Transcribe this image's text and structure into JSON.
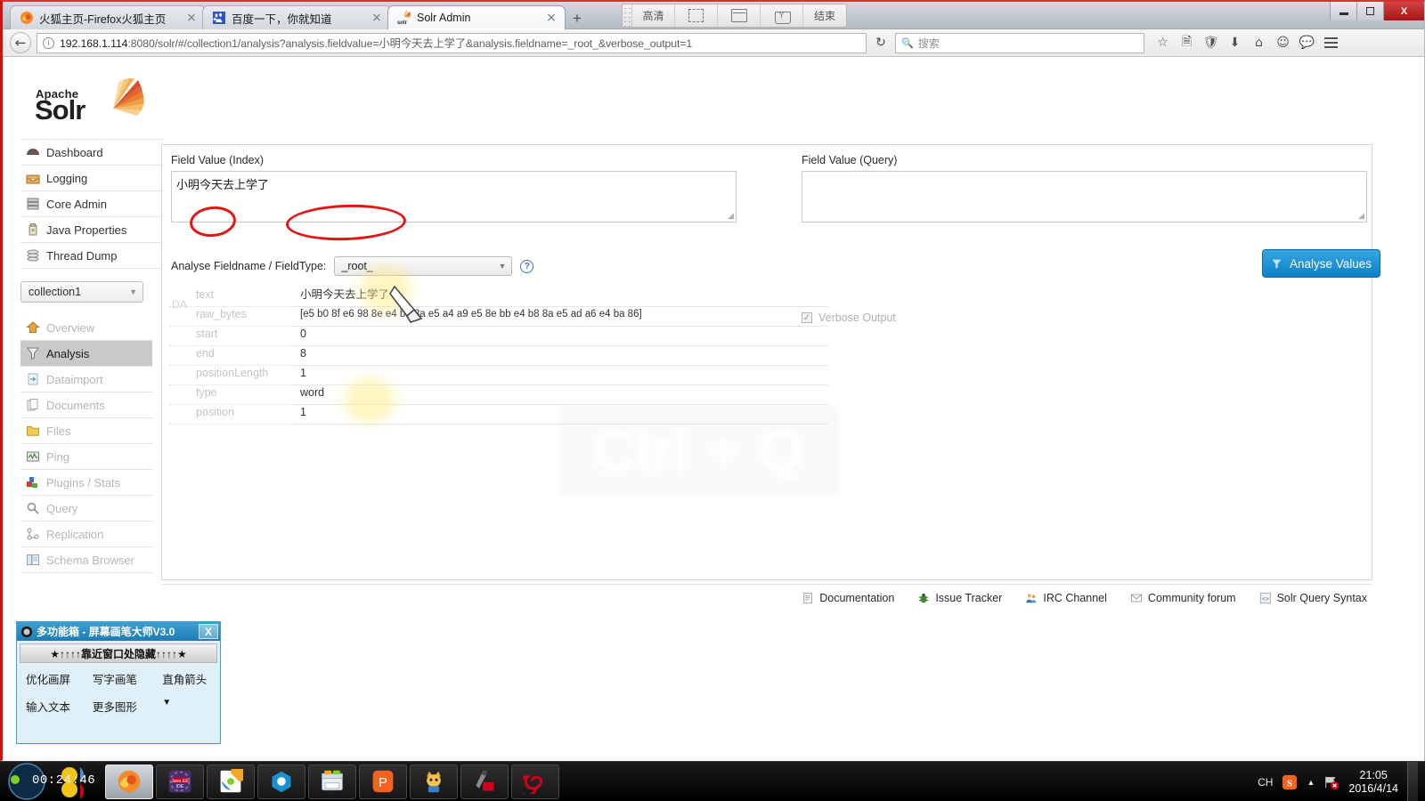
{
  "browser": {
    "tabs": [
      {
        "title": "火狐主页-Firefox火狐主页",
        "favicon": "firefox-icon",
        "active": false,
        "close": "×"
      },
      {
        "title": "百度一下，你就知道",
        "favicon": "baidu-icon",
        "active": false,
        "close": "×"
      },
      {
        "title": "Solr Admin",
        "favicon": "solr-icon",
        "active": true,
        "close": "×"
      }
    ],
    "new_tab_label": "+",
    "capture_toolbar": {
      "hd_label": "高清",
      "region_label": "region-select-icon",
      "window_label": "window-capture-icon",
      "scroll_label": "scroll-capture-icon",
      "end_label": "结束"
    },
    "window_controls": {
      "minimize": "minimize-icon",
      "maximize": "maximize-icon",
      "close": "X"
    },
    "nav": {
      "back_label": "←",
      "url_host": "192.168.1.114",
      "url_rest": ":8080/solr/#/collection1/analysis?analysis.fieldvalue=小明今天去上学了&analysis.fieldname=_root_&verbose_output=1",
      "reload_label": "↻",
      "search_placeholder": "搜索",
      "icons": [
        "bookmark-star-icon",
        "reading-list-icon",
        "shield-icon",
        "downloads-icon",
        "home-icon",
        "smiley-icon",
        "chat-icon",
        "menu-hamburger-icon"
      ]
    }
  },
  "solr": {
    "logo": {
      "apache": "Apache",
      "name": "Solr"
    },
    "main_menu": [
      {
        "label": "Dashboard",
        "icon": "dashboard-icon"
      },
      {
        "label": "Logging",
        "icon": "logging-icon"
      },
      {
        "label": "Core Admin",
        "icon": "core-admin-icon"
      },
      {
        "label": "Java Properties",
        "icon": "java-properties-icon"
      },
      {
        "label": "Thread Dump",
        "icon": "thread-dump-icon"
      }
    ],
    "core_selector": {
      "value": "collection1",
      "caret": "▼"
    },
    "core_menu": [
      {
        "label": "Overview",
        "icon": "overview-home-icon",
        "active": false
      },
      {
        "label": "Analysis",
        "icon": "analysis-funnel-icon",
        "active": true
      },
      {
        "label": "Dataimport",
        "icon": "dataimport-icon",
        "active": false
      },
      {
        "label": "Documents",
        "icon": "documents-icon",
        "active": false
      },
      {
        "label": "Files",
        "icon": "files-folder-icon",
        "active": false
      },
      {
        "label": "Ping",
        "icon": "ping-icon",
        "active": false
      },
      {
        "label": "Plugins / Stats",
        "icon": "plugins-stats-icon",
        "active": false
      },
      {
        "label": "Query",
        "icon": "query-magnifier-icon",
        "active": false
      },
      {
        "label": "Replication",
        "icon": "replication-icon",
        "active": false
      },
      {
        "label": "Schema Browser",
        "icon": "schema-browser-icon",
        "active": false
      }
    ],
    "index_panel": {
      "label": "Field Value (Index)",
      "value": "小明今天去上学了",
      "placeholder": ""
    },
    "query_panel": {
      "label": "Field Value (Query)",
      "value": "",
      "placeholder": ""
    },
    "fieldname_row": {
      "label": "Analyse Fieldname / FieldType:",
      "value": "_root_",
      "caret": "▼",
      "help": "?"
    },
    "verbose": {
      "label": "Verbose Output",
      "checked": true,
      "check_glyph": "✓"
    },
    "analyse_button": {
      "label": "Analyse Values",
      "icon": "funnel-icon",
      "color": "#1283c9"
    },
    "analysis_table": {
      "stage_label": "DA",
      "rows": [
        {
          "key": "text",
          "value": "小明今天去上学了"
        },
        {
          "key": "raw_bytes",
          "value": "[e5 b0 8f e6 98 8e e4 bb 8a e5 a4 a9 e5 8e bb e4 b8 8a e5 ad a6 e4 ba 86]"
        },
        {
          "key": "start",
          "value": "0"
        },
        {
          "key": "end",
          "value": "8"
        },
        {
          "key": "positionLength",
          "value": "1"
        },
        {
          "key": "type",
          "value": "word"
        },
        {
          "key": "position",
          "value": "1"
        }
      ]
    },
    "footer_links": [
      {
        "label": "Documentation",
        "icon": "document-icon"
      },
      {
        "label": "Issue Tracker",
        "icon": "bug-icon"
      },
      {
        "label": "IRC Channel",
        "icon": "people-icon"
      },
      {
        "label": "Community forum",
        "icon": "envelope-icon"
      },
      {
        "label": "Solr Query Syntax",
        "icon": "code-icon"
      }
    ]
  },
  "overlays": {
    "shortcut_watermark": "Ctrl + Q"
  },
  "tool_window": {
    "title": "多功能箱 - 屏幕画笔大师V3.0",
    "close": "X",
    "hide_bar": "★↑↑↑↑靠近窗口处隐藏↑↑↑↑★",
    "buttons": [
      [
        "优化画屏",
        "写字画笔",
        "直角箭头"
      ],
      [
        "输入文本",
        "更多图形",
        "▼"
      ]
    ]
  },
  "taskbar": {
    "clock_widget": "00:24:46",
    "items": [
      {
        "name": "firefox",
        "selected": true
      },
      {
        "name": "java-ee-ide",
        "selected": false
      },
      {
        "name": "color-app",
        "selected": false
      },
      {
        "name": "blue-app",
        "selected": false
      },
      {
        "name": "file-explorer",
        "selected": false
      },
      {
        "name": "powerpoint-app",
        "selected": false
      },
      {
        "name": "cat-app",
        "selected": false
      },
      {
        "name": "tool-app",
        "selected": false
      },
      {
        "name": "spiral-app",
        "selected": false
      }
    ],
    "tray": {
      "ime": "CH",
      "sogou": "sogou-icon",
      "expand": "▲",
      "network": "network-error-icon",
      "time": "21:05",
      "date": "2016/4/14"
    }
  }
}
